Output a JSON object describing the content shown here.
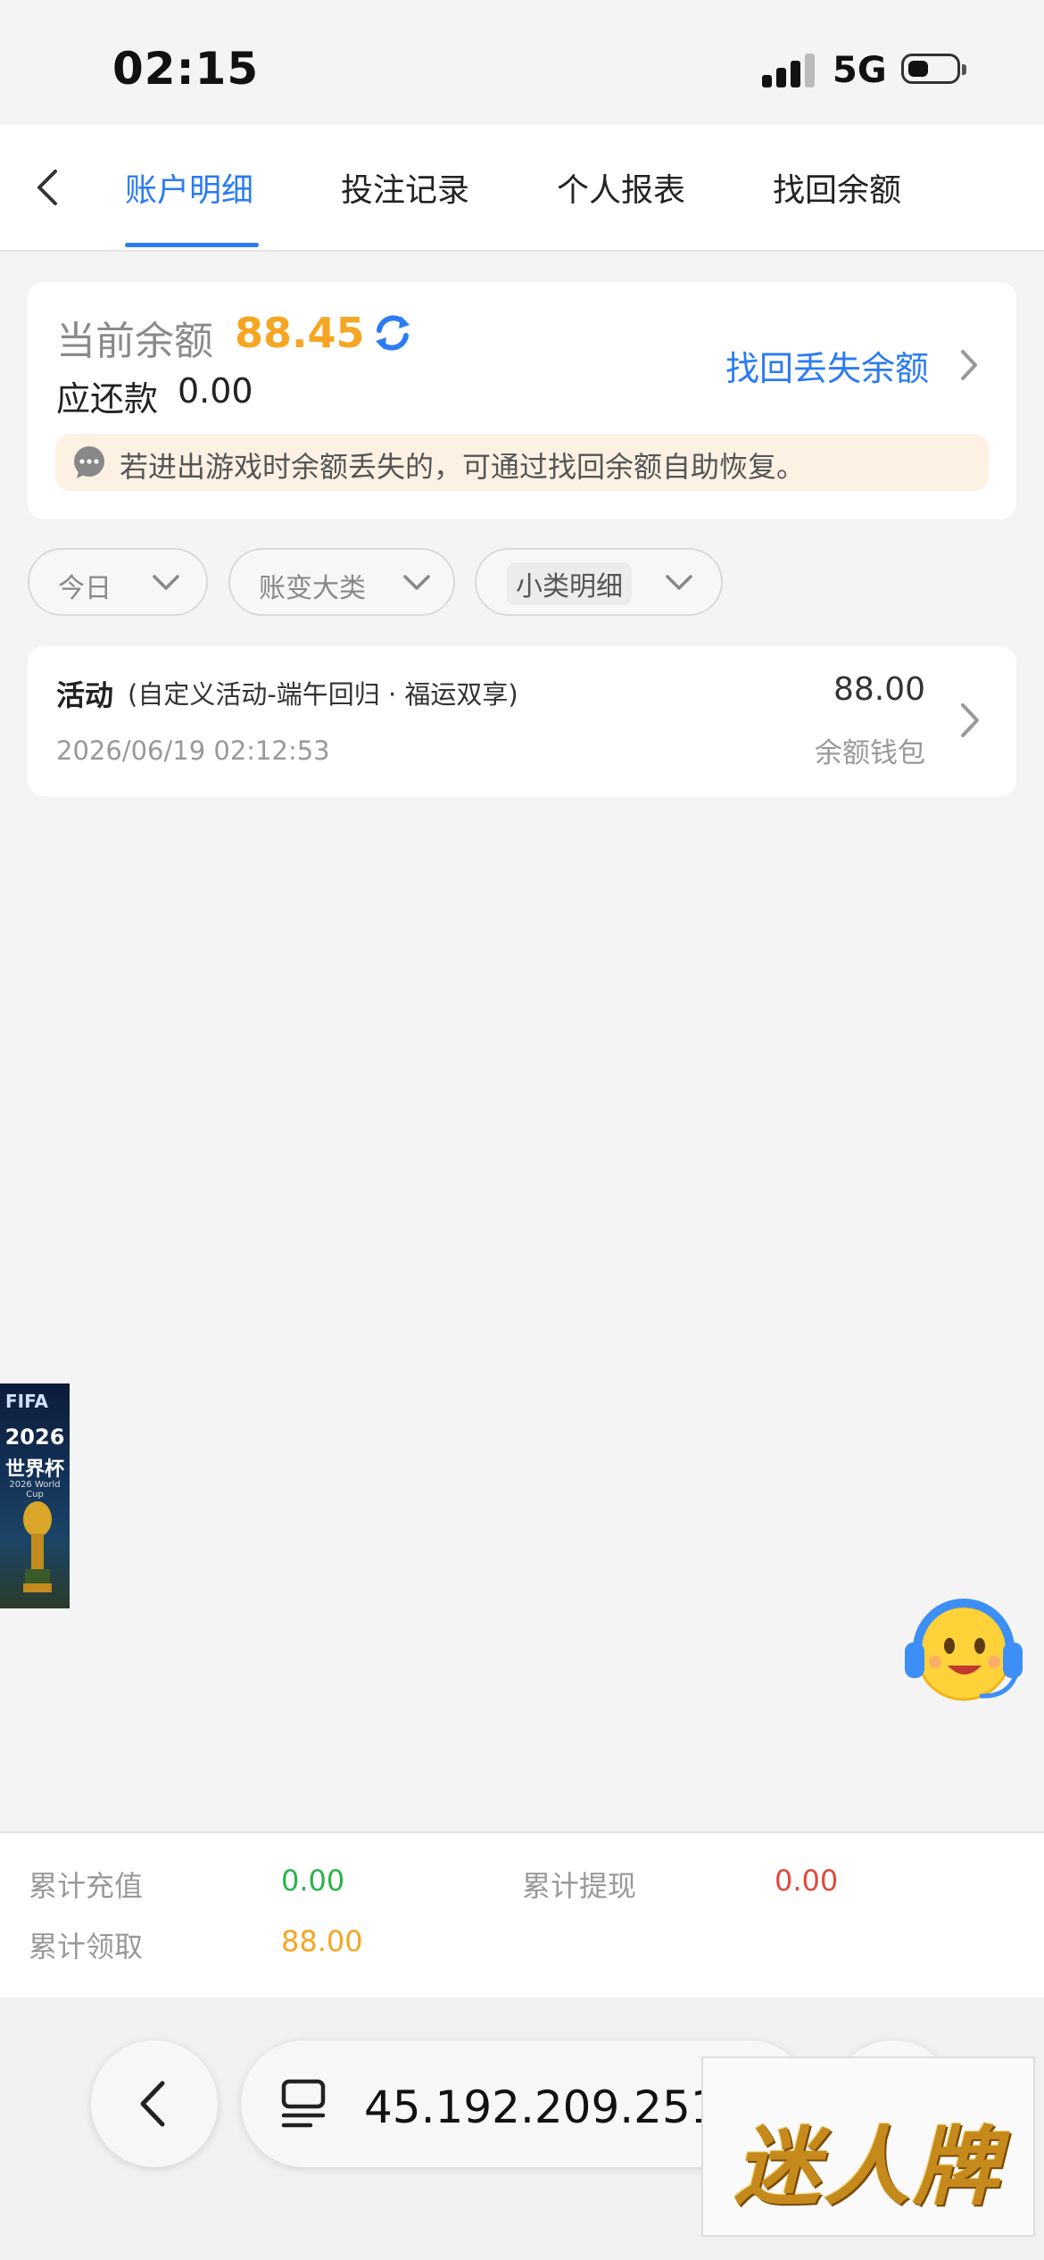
{
  "status_bar": {
    "time": "02:15",
    "network": "5G"
  },
  "header": {
    "tabs": [
      {
        "label": "账户明细",
        "active": true
      },
      {
        "label": "投注记录",
        "active": false
      },
      {
        "label": "个人报表",
        "active": false
      },
      {
        "label": "找回余额",
        "active": false
      }
    ]
  },
  "balance": {
    "label": "当前余额",
    "value": "88.45",
    "due_label": "应还款",
    "due_value": "0.00",
    "recover_link": "找回丢失余额",
    "notice": "若进出游戏时余额丢失的，可通过找回余额自助恢复。"
  },
  "filters": [
    {
      "label": "今日"
    },
    {
      "label": "账变大类"
    },
    {
      "label": "小类明细"
    }
  ],
  "records": [
    {
      "type": "活动",
      "desc": "(自定义活动-端午回归 · 福运双享)",
      "time": "2026/06/19 02:12:53",
      "amount": "88.00",
      "wallet": "余额钱包"
    }
  ],
  "promo_badge": {
    "logo_text": "FIFA",
    "year": "2026",
    "title": "世界杯",
    "subtitle": "2026 World Cup"
  },
  "totals": {
    "recharge_label": "累计充值",
    "recharge_value": "0.00",
    "withdraw_label": "累计提现",
    "withdraw_value": "0.00",
    "claim_label": "累计领取",
    "claim_value": "88.00"
  },
  "browser": {
    "url": "45.192.209.251"
  },
  "brand_overlay": {
    "text": "迷人牌"
  },
  "colors": {
    "accent_blue": "#2b7bf3",
    "orange": "#f5a623",
    "green": "#2bb24c",
    "red": "#e04a3c"
  },
  "icons": [
    "back-chevron-icon",
    "refresh-icon",
    "chevron-right-icon",
    "chat-bubble-icon",
    "chevron-down-icon",
    "customer-service-icon",
    "url-list-icon"
  ]
}
